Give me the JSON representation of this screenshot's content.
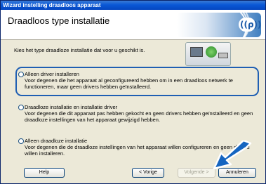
{
  "window": {
    "title": "Wizard instelling draadloos apparaat"
  },
  "header": {
    "title": "Draadloos type installatie"
  },
  "prompt": "Kies het type draadloze installatie dat voor u geschikt is.",
  "options": [
    {
      "title": "Alleen driver installeren",
      "desc": "Voor degenen die het apparaat al geconfigureerd hebben om in een draadloos netwerk te functioneren, maar geen drivers hebben geïnstalleerd."
    },
    {
      "title": "Draadloze installatie en installatie driver",
      "desc": "Voor degenen die dit apparaat pas hebben gekocht en geen drivers hebben geïnstalleerd en geen draadloze instellingen van het apparaat gewijzigd hebben."
    },
    {
      "title": "Alleen draadloze installatie",
      "desc": "Voor degenen die de draadloze instellingen van het apparaat willen configureren en geen drivers willen installeren."
    }
  ],
  "buttons": {
    "help": "Help",
    "back": "< Vorige",
    "next": "Volgende >",
    "cancel": "Annuleren"
  },
  "colors": {
    "titlebar": "#0a58d6",
    "highlight_box": "#1f5fb3",
    "arrow": "#1565c0"
  }
}
